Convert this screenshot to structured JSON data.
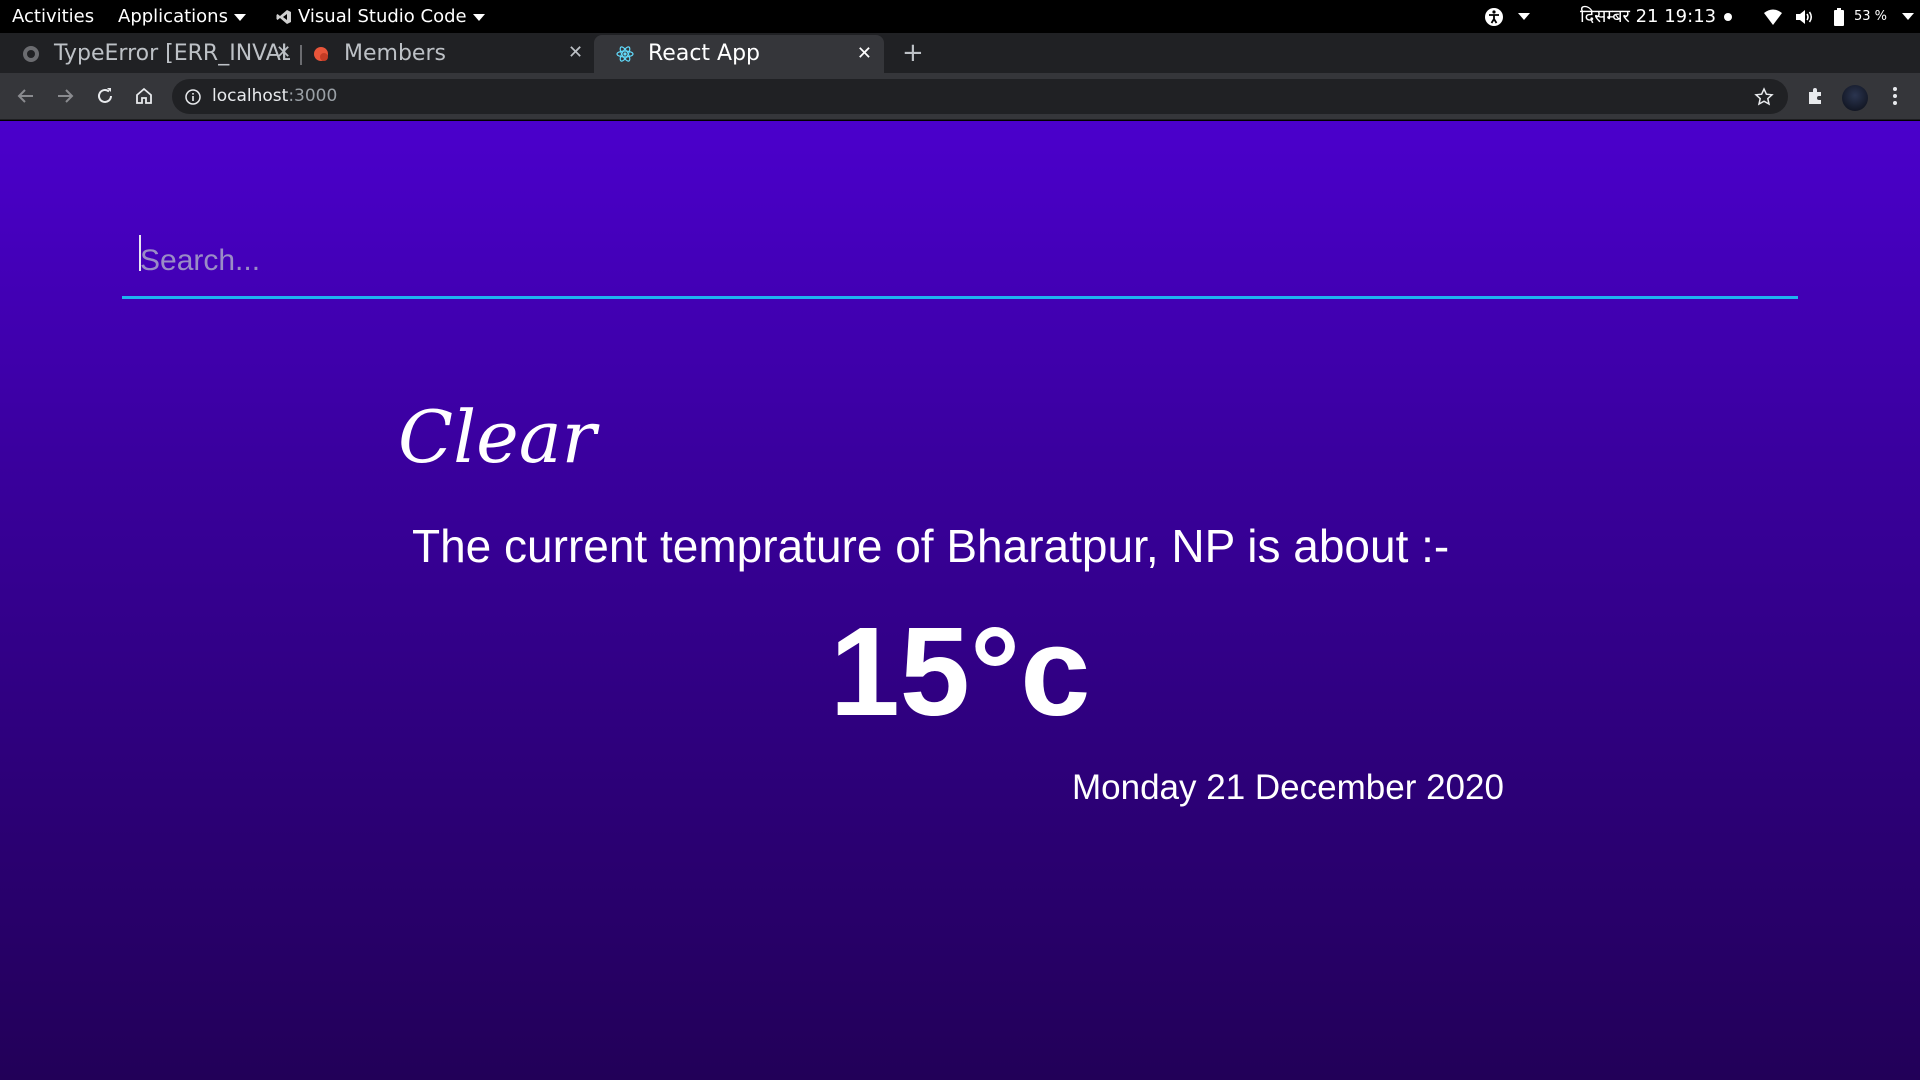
{
  "topbar": {
    "activities": "Activities",
    "applications": "Applications",
    "active_app": "Visual Studio Code",
    "datetime": "दिसम्बर 21  19:13",
    "battery": "53 %"
  },
  "browser": {
    "tabs": [
      {
        "title": "TypeError [ERR_INVALID",
        "favicon": "github-icon"
      },
      {
        "title": "Members",
        "favicon": "members-icon"
      },
      {
        "title": "React App",
        "favicon": "react-icon",
        "active": true
      }
    ],
    "new_tab": "+",
    "close_glyph": "✕",
    "url_host": "localhost",
    "url_port": ":3000"
  },
  "app": {
    "search_placeholder": "Search...",
    "weather_main": "Clear",
    "temp_description": "The current temprature of Bharatpur, NP is about :-",
    "temperature": "15°c",
    "date": "Monday 21 December 2020"
  },
  "colors": {
    "page_gradient_top": "#4b00cc",
    "page_gradient_bottom": "#220058",
    "search_underline": "#1eb4f0"
  }
}
